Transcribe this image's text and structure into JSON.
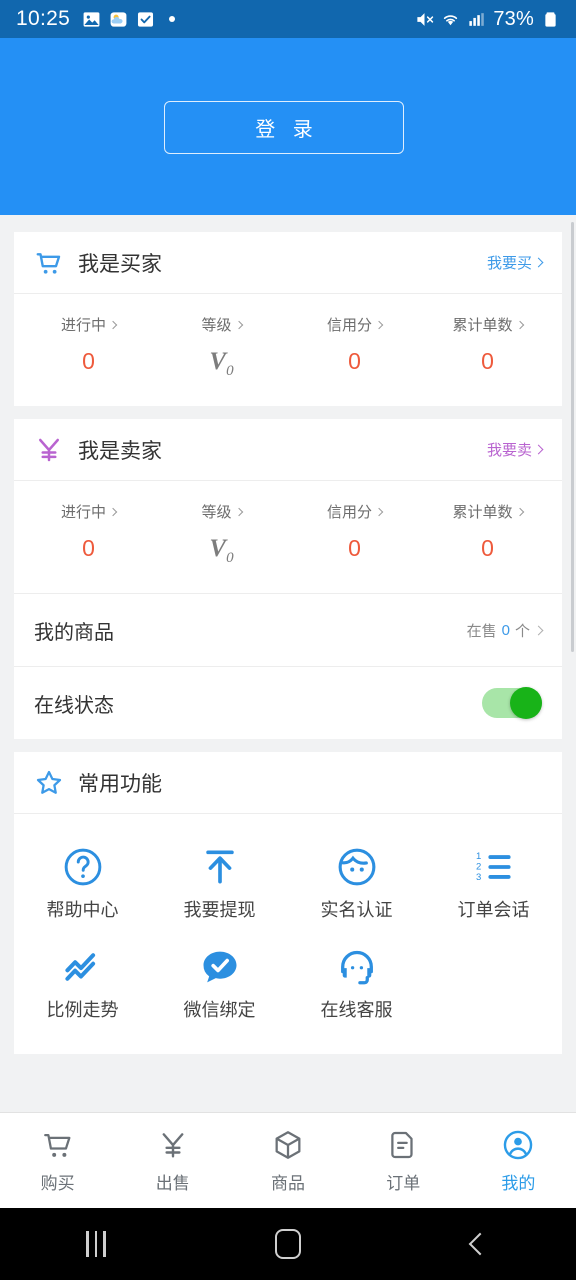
{
  "status_bar": {
    "time": "10:25",
    "battery_text": "73%",
    "icons": [
      "image-icon",
      "weather-icon",
      "checkbox-icon",
      "dot-icon",
      "mute-icon",
      "wifi-icon",
      "signal-icon",
      "battery-icon"
    ]
  },
  "hero": {
    "login_label": "登 录"
  },
  "buyer_card": {
    "icon": "shopping-cart-icon",
    "title": "我是买家",
    "link_label": "我要买",
    "link_color": "#3d9ae8",
    "stats": [
      {
        "label": "进行中",
        "value": "0"
      },
      {
        "label": "等级",
        "value": "V",
        "sub": "0"
      },
      {
        "label": "信用分",
        "value": "0"
      },
      {
        "label": "累计单数",
        "value": "0"
      }
    ]
  },
  "seller_card": {
    "icon": "yen-icon",
    "title": "我是卖家",
    "link_label": "我要卖",
    "link_color": "#b964d0",
    "stats": [
      {
        "label": "进行中",
        "value": "0"
      },
      {
        "label": "等级",
        "value": "V",
        "sub": "0"
      },
      {
        "label": "信用分",
        "value": "0"
      },
      {
        "label": "累计单数",
        "value": "0"
      }
    ],
    "my_goods": {
      "label": "我的商品",
      "prefix": "在售",
      "count": "0",
      "suffix": "个"
    },
    "online_status": {
      "label": "在线状态",
      "enabled": true,
      "on_color": "#18b318"
    }
  },
  "functions_card": {
    "icon": "star-icon",
    "title": "常用功能",
    "items": [
      {
        "label": "帮助中心",
        "icon": "question-circle-icon"
      },
      {
        "label": "我要提现",
        "icon": "withdraw-arrow-icon"
      },
      {
        "label": "实名认证",
        "icon": "face-id-icon"
      },
      {
        "label": "订单会话",
        "icon": "numbered-list-icon"
      },
      {
        "label": "比例走势",
        "icon": "trend-chart-icon"
      },
      {
        "label": "微信绑定",
        "icon": "chat-check-icon"
      },
      {
        "label": "在线客服",
        "icon": "headset-support-icon"
      }
    ]
  },
  "tab_bar": {
    "active_color": "#2c9ce8",
    "items": [
      {
        "label": "购买",
        "icon": "cart-icon",
        "active": false
      },
      {
        "label": "出售",
        "icon": "yen-icon",
        "active": false
      },
      {
        "label": "商品",
        "icon": "box-icon",
        "active": false
      },
      {
        "label": "订单",
        "icon": "order-doc-icon",
        "active": false
      },
      {
        "label": "我的",
        "icon": "user-circle-icon",
        "active": true
      }
    ]
  },
  "android_nav": {
    "recent_label": "recent-apps",
    "home_label": "home",
    "back_label": "back"
  }
}
